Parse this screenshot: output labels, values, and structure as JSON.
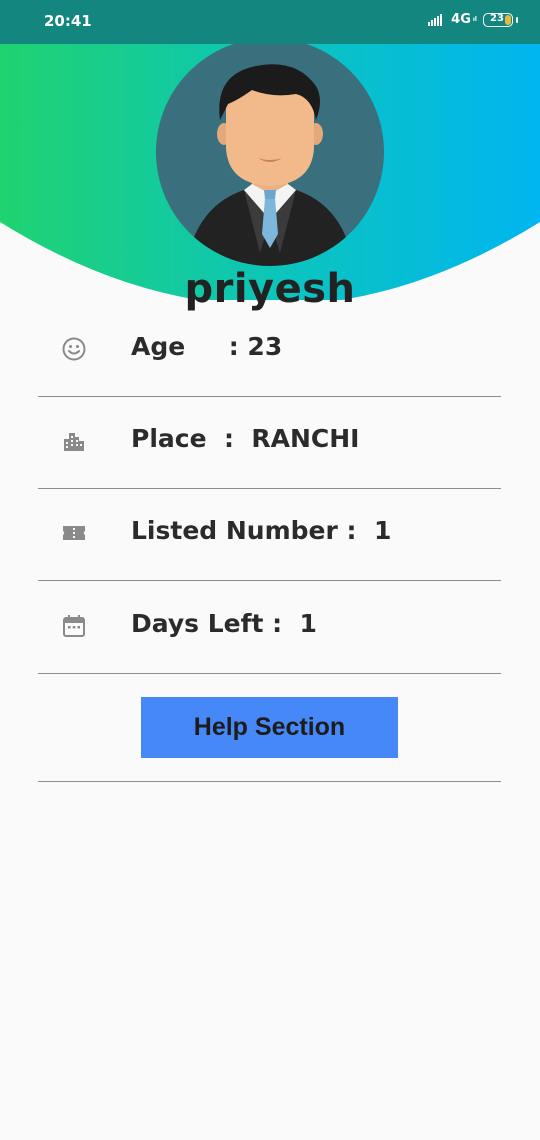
{
  "status_bar": {
    "time": "20:41",
    "network": "4G",
    "network_sub": "ıl",
    "battery": "23",
    "icons": [
      "signal-icon",
      "battery-icon"
    ]
  },
  "header": {
    "gradient_start": "#1fd36f",
    "gradient_end": "#00b5f0",
    "avatar_bg": "#3a6f7d"
  },
  "profile": {
    "name": "priyesh"
  },
  "info_rows": [
    {
      "icon": "smiley-icon",
      "text": "Age     : 23"
    },
    {
      "icon": "city-icon",
      "text": "Place  :  RANCHI"
    },
    {
      "icon": "ticket-icon",
      "text": "Listed Number :  1"
    },
    {
      "icon": "calendar-icon",
      "text": "Days Left :  1"
    }
  ],
  "help": {
    "label": "Help Section",
    "color": "#4688f8"
  },
  "colors": {
    "background": "#fafafa",
    "status_bar": "#13877f",
    "icon_gray": "#8a8a8a"
  }
}
